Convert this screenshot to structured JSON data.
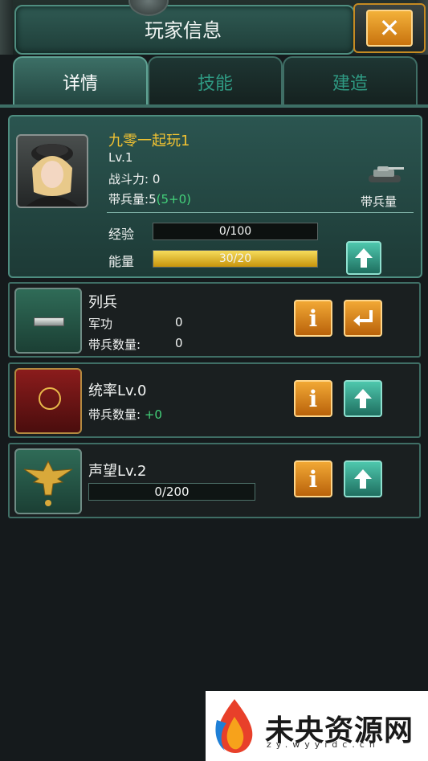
{
  "header": {
    "title": "玩家信息",
    "close_label": "✕"
  },
  "tabs": [
    {
      "label": "详情",
      "active": true
    },
    {
      "label": "技能",
      "active": false
    },
    {
      "label": "建造",
      "active": false
    }
  ],
  "player": {
    "name": "九零一起玩1",
    "level": "Lv.1",
    "power_label": "战斗力:",
    "power_value": "0",
    "troop_label": "带兵量:",
    "troop_value": "5",
    "troop_bonus": "(5+0)",
    "troop_icon_label": "带兵量",
    "exp": {
      "label": "经验",
      "text": "0/100",
      "fraction": 0.0
    },
    "energy": {
      "label": "能量",
      "text": "30/20",
      "fraction": 1.0
    }
  },
  "rank": {
    "title": "列兵",
    "merit_label": "军功",
    "merit_value": "0",
    "troops_label": "带兵数量:",
    "troops_value": "0"
  },
  "command": {
    "title": "统率Lv.0",
    "troops_label": "带兵数量:",
    "troops_value": "+0"
  },
  "prestige": {
    "title": "声望Lv.2",
    "progress_text": "0/200",
    "fraction": 0.0
  },
  "watermark": {
    "text": "未央资源网",
    "sub": "zy.wyyidc.cn"
  },
  "colors": {
    "accent": "#4e8d80",
    "gold": "#f1c232",
    "green": "#43d17a"
  }
}
